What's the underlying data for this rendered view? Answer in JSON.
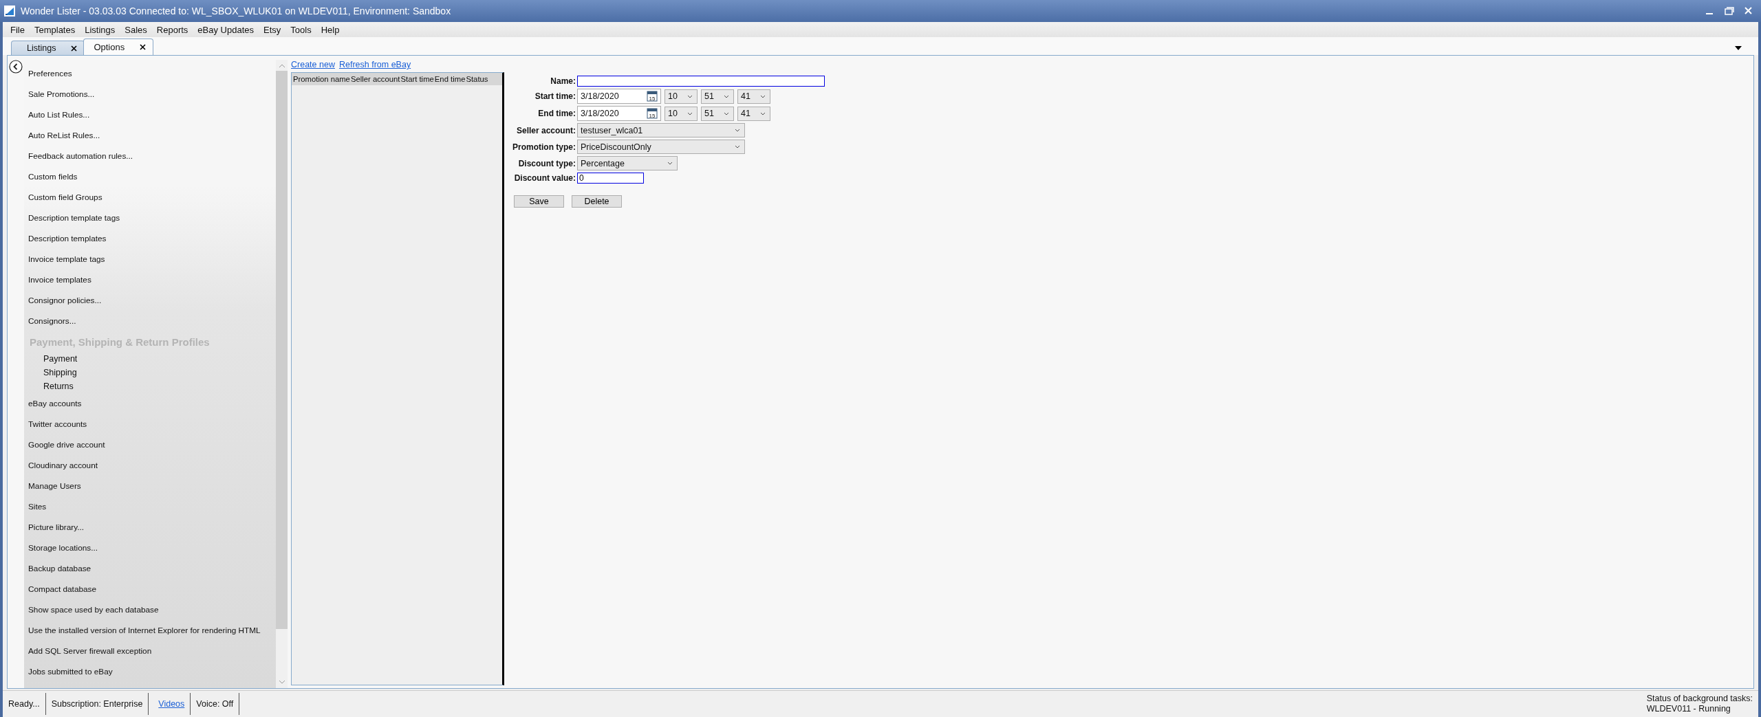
{
  "window": {
    "title": "Wonder Lister - 03.03.03 Connected to: WL_SBOX_WLUK01 on WLDEV011, Environment: Sandbox"
  },
  "menu": [
    "File",
    "Templates",
    "Listings",
    "Sales",
    "Reports",
    "eBay Updates",
    "Etsy",
    "Tools",
    "Help"
  ],
  "tabs": [
    {
      "label": "Listings",
      "selected": false
    },
    {
      "label": "Options",
      "selected": true
    }
  ],
  "sidebar": {
    "items": [
      {
        "kind": "item",
        "label": "Preferences"
      },
      {
        "kind": "item",
        "label": "Sale Promotions..."
      },
      {
        "kind": "item",
        "label": "Auto List Rules..."
      },
      {
        "kind": "item",
        "label": "Auto ReList Rules..."
      },
      {
        "kind": "item",
        "label": "Feedback automation rules..."
      },
      {
        "kind": "item",
        "label": "Custom fields"
      },
      {
        "kind": "item",
        "label": "Custom field Groups"
      },
      {
        "kind": "item",
        "label": "Description template tags"
      },
      {
        "kind": "item",
        "label": "Description templates"
      },
      {
        "kind": "item",
        "label": "Invoice template tags"
      },
      {
        "kind": "item",
        "label": "Invoice templates"
      },
      {
        "kind": "item",
        "label": "Consignor policies..."
      },
      {
        "kind": "item",
        "label": "Consignors..."
      },
      {
        "kind": "header",
        "label": "Payment, Shipping & Return Profiles",
        "children": [
          {
            "label": "Payment"
          },
          {
            "label": "Shipping"
          },
          {
            "label": "Returns"
          }
        ]
      },
      {
        "kind": "item",
        "label": "eBay accounts"
      },
      {
        "kind": "item",
        "label": "Twitter accounts"
      },
      {
        "kind": "item",
        "label": "Google drive account"
      },
      {
        "kind": "item",
        "label": "Cloudinary account"
      },
      {
        "kind": "item",
        "label": "Manage Users"
      },
      {
        "kind": "item",
        "label": "Sites"
      },
      {
        "kind": "item",
        "label": "Picture library..."
      },
      {
        "kind": "item",
        "label": "Storage locations..."
      },
      {
        "kind": "item",
        "label": "Backup database"
      },
      {
        "kind": "item",
        "label": "Compact database"
      },
      {
        "kind": "item",
        "label": "Show space used by each database"
      },
      {
        "kind": "item",
        "label": "Use the installed version of Internet Explorer for rendering HTML"
      },
      {
        "kind": "item",
        "label": "Add SQL Server firewall exception"
      },
      {
        "kind": "item",
        "label": "Jobs submitted to eBay"
      }
    ]
  },
  "promotions": {
    "links": [
      "Create new",
      "Refresh from eBay"
    ],
    "columns": [
      "Promotion name",
      "Seller account",
      "Start time",
      "End time",
      "Status"
    ]
  },
  "form": {
    "fields": [
      {
        "kind": "text",
        "label": "Name:"
      },
      {
        "kind": "datetime",
        "label": "Start time:",
        "date": "3/18/2020",
        "calendar_day": "15",
        "hour": "10",
        "minute": "51",
        "second": "41"
      },
      {
        "kind": "datetime",
        "label": "End time:",
        "date": "3/18/2020",
        "calendar_day": "15",
        "hour": "10",
        "minute": "51",
        "second": "41"
      },
      {
        "kind": "combo",
        "label": "Seller account:",
        "value": "testuser_wlca01"
      },
      {
        "kind": "combo",
        "label": "Promotion type:",
        "value": "PriceDiscountOnly"
      },
      {
        "kind": "combo",
        "label": "Discount type:",
        "value": "Percentage"
      },
      {
        "kind": "text",
        "label": "Discount value:",
        "value": "0"
      }
    ],
    "buttons": [
      "Save",
      "Delete"
    ]
  },
  "status_bar": {
    "ready": "Ready...",
    "subscription": "Subscription: Enterprise",
    "videos": "Videos",
    "voice": "Voice:  Off",
    "tasks_title": "Status of background tasks:",
    "tasks_status": "WLDEV011 - Running"
  }
}
